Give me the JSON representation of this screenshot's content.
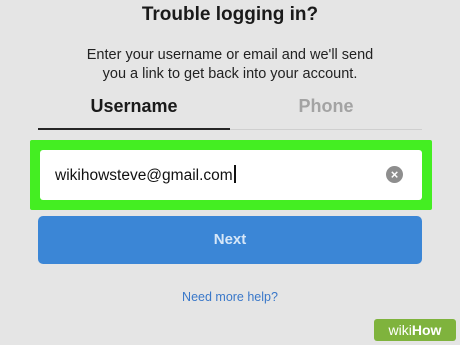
{
  "header": {
    "title": "Trouble logging in?",
    "description_line1": "Enter your username or email and we'll send",
    "description_line2": "you a link to get back into your account."
  },
  "tabs": [
    {
      "label": "Username",
      "active": true
    },
    {
      "label": "Phone",
      "active": false
    }
  ],
  "input": {
    "value": "wikihowsteve@gmail.com",
    "clear_icon": "clear-icon"
  },
  "next_button": {
    "label": "Next"
  },
  "help": {
    "link": "Need more help?"
  },
  "watermark": {
    "brand_prefix": "wiki",
    "brand_suffix": "How"
  },
  "colors": {
    "background": "#e5e5e5",
    "highlight": "#44ee22",
    "primary_button": "#3b86d6",
    "link": "#3a78c9",
    "watermark": "#7fb33d"
  }
}
